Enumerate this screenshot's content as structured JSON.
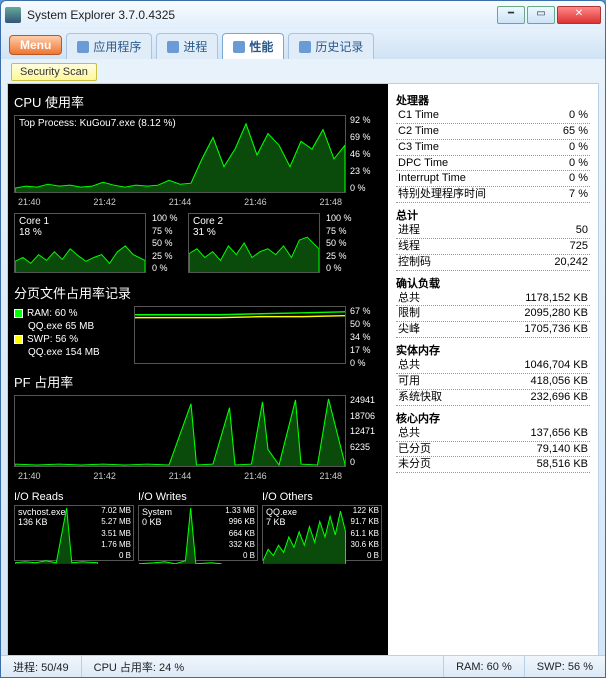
{
  "window": {
    "title": "System Explorer 3.7.0.4325"
  },
  "menu_label": "Menu",
  "tabs": [
    {
      "label": "应用程序"
    },
    {
      "label": "进程"
    },
    {
      "label": "性能"
    },
    {
      "label": "历史记录"
    }
  ],
  "security_scan": "Security Scan",
  "cpu": {
    "title": "CPU 使用率",
    "top_process": "Top Process: KuGou7.exe (8.12 %)",
    "yaxis": [
      "92 %",
      "69 %",
      "46 %",
      "23 %",
      "0 %"
    ],
    "xaxis": [
      "21:40",
      "21:42",
      "21:44",
      "21:46",
      "21:48"
    ],
    "core1_label": "Core 1",
    "core1_pct": "18 %",
    "core2_label": "Core 2",
    "core2_pct": "31 %",
    "core_yaxis": [
      "100 %",
      "75 %",
      "50 %",
      "25 %",
      "0 %"
    ]
  },
  "pagefile": {
    "title": "分页文件占用率记录",
    "ram_label": "RAM: 60 %",
    "ram_proc": "QQ.exe 65 MB",
    "swp_label": "SWP: 56 %",
    "swp_proc": "QQ.exe 154 MB",
    "yaxis": [
      "67 %",
      "50 %",
      "34 %",
      "17 %",
      "0 %"
    ]
  },
  "pf": {
    "title": "PF 占用率",
    "yaxis": [
      "24941",
      "18706",
      "12471",
      "6235",
      "0"
    ],
    "xaxis": [
      "21:40",
      "21:42",
      "21:44",
      "21:46",
      "21:48"
    ]
  },
  "io": {
    "reads_title": "I/O Reads",
    "writes_title": "I/O Writes",
    "others_title": "I/O Others",
    "reads_proc": "svchost.exe",
    "reads_val": "136 KB",
    "reads_yaxis": [
      "7.02 MB",
      "5.27 MB",
      "3.51 MB",
      "1.76 MB",
      "0 B"
    ],
    "writes_proc": "System",
    "writes_val": "0 KB",
    "writes_yaxis": [
      "1.33 MB",
      "996 KB",
      "664 KB",
      "332 KB",
      "0 B"
    ],
    "others_proc": "QQ.exe",
    "others_val": "7 KB",
    "others_yaxis": [
      "122 KB",
      "91.7 KB",
      "61.1 KB",
      "30.6 KB",
      "0 B"
    ]
  },
  "right": {
    "processor": "处理器",
    "c1": {
      "k": "C1 Time",
      "v": "0 %"
    },
    "c2": {
      "k": "C2 Time",
      "v": "65 %"
    },
    "c3": {
      "k": "C3 Time",
      "v": "0 %"
    },
    "dpc": {
      "k": "DPC Time",
      "v": "0 %"
    },
    "int": {
      "k": "Interrupt Time",
      "v": "0 %"
    },
    "spec": {
      "k": "特别处理程序时间",
      "v": "7 %"
    },
    "totals": "总计",
    "procs": {
      "k": "进程",
      "v": "50"
    },
    "threads": {
      "k": "线程",
      "v": "725"
    },
    "handles": {
      "k": "控制码",
      "v": "20,242"
    },
    "commit": "确认负载",
    "c_total": {
      "k": "总共",
      "v": "1178,152 KB"
    },
    "c_limit": {
      "k": "限制",
      "v": "2095,280 KB"
    },
    "c_peak": {
      "k": "尖峰",
      "v": "1705,736 KB"
    },
    "physmem": "实体内存",
    "p_total": {
      "k": "总共",
      "v": "1046,704 KB"
    },
    "p_avail": {
      "k": "可用",
      "v": "418,056 KB"
    },
    "p_cache": {
      "k": "系统快取",
      "v": "232,696 KB"
    },
    "kernel": "核心内存",
    "k_total": {
      "k": "总共",
      "v": "137,656 KB"
    },
    "k_paged": {
      "k": "已分页",
      "v": "79,140 KB"
    },
    "k_nonpaged": {
      "k": "未分页",
      "v": "58,516 KB"
    }
  },
  "status": {
    "procs": "进程: 50/49",
    "cpu": "CPU 占用率: 24 %",
    "ram": "RAM: 60 %",
    "swp": "SWP: 56 %"
  },
  "chart_data": [
    {
      "type": "line",
      "title": "CPU 使用率",
      "x": [
        "21:40",
        "21:42",
        "21:44",
        "21:46",
        "21:48"
      ],
      "ylim": [
        0,
        92
      ],
      "values": [
        5,
        8,
        6,
        10,
        7,
        9,
        6,
        8,
        12,
        5,
        7,
        6,
        9,
        7,
        8,
        15,
        10,
        40,
        65,
        30,
        50,
        85,
        45,
        70,
        55,
        30,
        60,
        50,
        75,
        40
      ],
      "ylabel": "%"
    },
    {
      "type": "line",
      "title": "Core 1",
      "values": [
        18,
        25,
        15,
        30,
        20,
        35,
        22,
        40,
        28,
        18,
        25,
        20,
        30,
        15,
        35,
        45,
        30,
        20
      ],
      "ylim": [
        0,
        100
      ]
    },
    {
      "type": "line",
      "title": "Core 2",
      "values": [
        31,
        40,
        25,
        35,
        20,
        45,
        30,
        50,
        25,
        35,
        40,
        30,
        45,
        25,
        55,
        60,
        40,
        35
      ],
      "ylim": [
        0,
        100
      ]
    },
    {
      "type": "line",
      "title": "分页文件 RAM",
      "values": [
        59,
        59,
        60,
        60,
        60,
        60,
        60,
        60,
        60,
        60,
        60,
        60,
        60,
        60,
        60,
        60,
        60,
        60
      ],
      "ylim": [
        0,
        67
      ]
    },
    {
      "type": "line",
      "title": "PF 占用率",
      "x": [
        "21:40",
        "21:42",
        "21:44",
        "21:46",
        "21:48"
      ],
      "values": [
        500,
        400,
        600,
        300,
        500,
        400,
        700,
        500,
        400,
        600,
        500,
        400,
        600,
        500,
        22000,
        400,
        500,
        20000,
        600,
        500,
        400,
        23000,
        500,
        18000,
        600,
        500,
        24000,
        500,
        400
      ],
      "ylim": [
        0,
        24941
      ]
    },
    {
      "type": "line",
      "title": "I/O Reads",
      "values": [
        100,
        80,
        150,
        90,
        120,
        200,
        100,
        300,
        80,
        150,
        7000000,
        100,
        120
      ],
      "ylim": [
        0,
        7363000
      ],
      "top_process": "svchost.exe 136 KB"
    },
    {
      "type": "line",
      "title": "I/O Writes",
      "values": [
        0,
        0,
        50,
        0,
        100,
        0,
        200,
        0,
        50,
        0,
        1300000,
        0,
        0
      ],
      "ylim": [
        0,
        1394000
      ],
      "top_process": "System 0 KB"
    },
    {
      "type": "line",
      "title": "I/O Others",
      "values": [
        5,
        30,
        15,
        40,
        20,
        60,
        25,
        50,
        35,
        70,
        40,
        90,
        30,
        80,
        45,
        100,
        35,
        120,
        50
      ],
      "ylim": [
        0,
        125000
      ],
      "top_process": "QQ.exe 7 KB"
    }
  ]
}
